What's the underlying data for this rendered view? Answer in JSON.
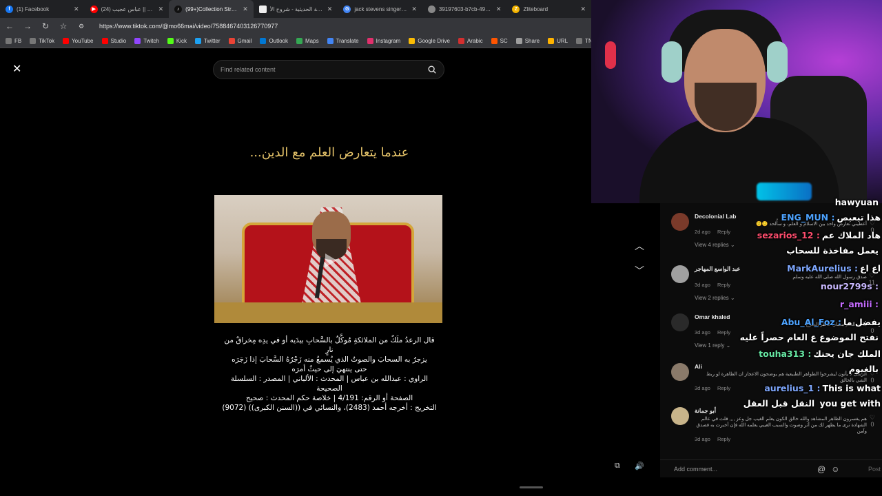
{
  "tabs": [
    {
      "title": "(1) Facebook",
      "color": "#1877f2",
      "glyph": "f"
    },
    {
      "title": "(24) اجمل ساقي || عباس عجيب",
      "color": "#ff0000",
      "glyph": "▶"
    },
    {
      "title": "(99+)Collection Stream",
      "color": "#111111",
      "glyph": "♪",
      "active": true
    },
    {
      "title": "الموسوعة الحديثية - شروح الأ",
      "color": "#eeeeee",
      "glyph": ""
    },
    {
      "title": "jack stevens singer - Google",
      "color": "#4285f4",
      "glyph": "G"
    },
    {
      "title": "39197603-b7cb-496e-8b98",
      "color": "#888888",
      "glyph": ""
    },
    {
      "title": "Zliteboard",
      "color": "#f4b400",
      "glyph": "Z"
    }
  ],
  "address": {
    "url": "https://www.tiktok.com/@mo66mai/video/7588467403126770977"
  },
  "bookmarks": [
    {
      "label": "FB",
      "color": "#777777"
    },
    {
      "label": "TikTok",
      "color": "#777777"
    },
    {
      "label": "YouTube",
      "color": "#ff0000"
    },
    {
      "label": "Studio",
      "color": "#ff0000"
    },
    {
      "label": "Twitch",
      "color": "#9146ff"
    },
    {
      "label": "Kick",
      "color": "#53fc18"
    },
    {
      "label": "Twitter",
      "color": "#1da1f2"
    },
    {
      "label": "Gmail",
      "color": "#ea4335"
    },
    {
      "label": "Outlook",
      "color": "#0078d4"
    },
    {
      "label": "Maps",
      "color": "#34a853"
    },
    {
      "label": "Translate",
      "color": "#4285f4"
    },
    {
      "label": "Instagram",
      "color": "#e1306c"
    },
    {
      "label": "Google Drive",
      "color": "#fbbc04"
    },
    {
      "label": "Arabic",
      "color": "#d32f2f"
    },
    {
      "label": "SC",
      "color": "#ff5500"
    },
    {
      "label": "Share",
      "color": "#9e9e9e"
    },
    {
      "label": "URL",
      "color": "#ffb300"
    },
    {
      "label": "TN",
      "color": "#777777"
    },
    {
      "label": "Ch",
      "color": "#777777"
    }
  ],
  "search": {
    "placeholder": "Find related content"
  },
  "video": {
    "title": "عندما يتعارض العلم مع الدين...",
    "caption_lines": [
      "قال الرعدُ ملَكٌ من الملائكةِ مُوكَّلٌ بالسَّحابِ بيدَيه أو في يدِه مِخراقٌ من نارٍ",
      "يزجرُ به السحابَ والصوتُ الذي يُسمعُ منه زَجْرُهُ السَّحابَ إذا زَجَرَه",
      "حتى ينتهيَ إلى حيثُ أمرَه",
      "الراوي : عبدالله بن عباس | المحدث : الألباني | المصدر : السلسلة الصحيحة",
      "الصفحة أو الرقم: 4/191 | خلاصة حكم المحدث : صحيح",
      "التخريج : أخرجه أحمد (2483)، والنسائي في ((السنن الكبرى)) (9072)"
    ]
  },
  "comments": [
    {
      "name": "Decolonial Lab",
      "text": "أعطيني تعارض واحد بين الاسلام و العلم، و سأُلحد 🙂🙂",
      "date": "2d ago",
      "reply": "Reply",
      "replies": "View 4 replies",
      "likes": "0",
      "avatar": "#7a3a2a"
    },
    {
      "name": "عبد الواسع المهاجر",
      "text": "صدق رسول الله صلى الله عليه وسلم",
      "date": "3d ago",
      "reply": "Reply",
      "replies": "View 2 replies",
      "likes": "11",
      "avatar": "#a0a0a0"
    },
    {
      "name": "Omar khaled",
      "text": "مادي العلم مشان خاطر الشرع",
      "date": "3d ago",
      "reply": "Reply",
      "replies": "View 1 reply",
      "likes": "0",
      "avatar": "#2a2a2a"
    },
    {
      "name": "Ali",
      "text": "الرسل لا يأتون ليشرحوا الظواهر الطبيعية هم يوضحون الاعجاز ان الظاهرة لو ربط الشي بالخالق",
      "date": "3d ago",
      "reply": "Reply",
      "replies": "",
      "likes": "0",
      "avatar": "#8a7a6a"
    },
    {
      "name": "أبو جمانة",
      "text": "هم يفسرون الظاهر المشاهد والله خالق الكون يعلم الغيب جل وعز ,,,, فلت في عالم الشهادة ترى ما يظهر لك من أثر وصوت والسبب الغيبي يعلمه الله فإن أخبرت به فصدق وآمن",
      "date": "3d ago",
      "reply": "Reply",
      "replies": "",
      "likes": "0",
      "avatar": "#c8b48a"
    }
  ],
  "add_comment": {
    "placeholder": "Add comment...",
    "post": "Post"
  },
  "chat": [
    {
      "user": "hawyuan",
      "msg": "",
      "color": "#ffffff"
    },
    {
      "user": "ENG_MUN :",
      "msg": "هذا تبعبص",
      "color": "#4da3ff"
    },
    {
      "user": "sezarios_12 :",
      "msg": "هاد الملاك عم",
      "color": "#ff4d6d"
    },
    {
      "user": "",
      "msg": "يعمل مفاخذة للسحاب",
      "color": "#ffffff"
    },
    {
      "user": "MarkAurelius :",
      "msg": "اع اع",
      "color": "#7fa8ff"
    },
    {
      "user": "nour2799s :",
      "msg": "",
      "color": "#c9b8ff"
    },
    {
      "user": "r_amiii :",
      "msg": "",
      "color": "#c56bff"
    },
    {
      "user": "Abu_Al_Foz :",
      "msg": "يفضل ما",
      "color": "#4da3ff"
    },
    {
      "user": "",
      "msg": "نفتح الموضوع ع العام حصراً عليه",
      "color": "#ffffff"
    },
    {
      "user": "touha313 :",
      "msg": "الملك جان يحتك",
      "color": "#67e8a4"
    },
    {
      "user": "",
      "msg": "بالغيوم",
      "color": "#ffffff"
    },
    {
      "user": "aurelius_1 :",
      "msg": "This is what",
      "color": "#7fa8ff"
    },
    {
      "user": "",
      "msg": "you get with النقل قبل العقل",
      "color": "#ffffff"
    }
  ]
}
